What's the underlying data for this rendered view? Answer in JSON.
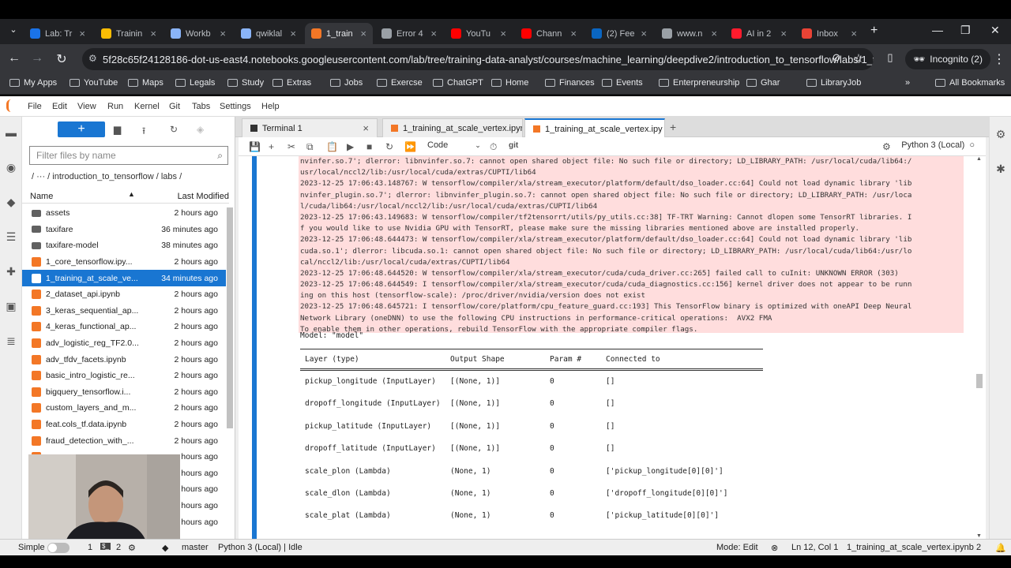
{
  "browser": {
    "tabs": [
      {
        "label": "Lab: Tr",
        "icon": "c-icon",
        "color": "#1a73e8"
      },
      {
        "label": "Trainin",
        "icon": "training-icon",
        "color": "#fbbc04"
      },
      {
        "label": "Workb",
        "icon": "workbench-icon",
        "color": "#8ab4f8"
      },
      {
        "label": "qwiklal",
        "icon": "qwiklabs-icon",
        "color": "#8ab4f8"
      },
      {
        "label": "1_train",
        "icon": "jupyter-icon",
        "color": "#f37726",
        "active": true
      },
      {
        "label": "Error 4",
        "icon": "globe-icon",
        "color": "#9aa0a6"
      },
      {
        "label": "YouTu",
        "icon": "youtube-icon",
        "color": "#ff0000"
      },
      {
        "label": "Chann",
        "icon": "youtube-icon",
        "color": "#ff0000"
      },
      {
        "label": "(2) Fee",
        "icon": "linkedin-icon",
        "color": "#0a66c2"
      },
      {
        "label": "www.n",
        "icon": "globe-icon",
        "color": "#9aa0a6"
      },
      {
        "label": "AI in 2",
        "icon": "opera-icon",
        "color": "#ff1b2d"
      },
      {
        "label": "Inbox",
        "icon": "gmail-icon",
        "color": "#ea4335"
      }
    ],
    "url": "5f28c65f24128186-dot-us-east4.notebooks.googleusercontent.com/lab/tree/training-data-analyst/courses/machine_learning/deepdive2/introduction_to_tensorflow/labs/1_train...",
    "incognito": "Incognito (2)",
    "bookmarks": [
      "My Apps",
      "YouTube",
      "Maps",
      "Legals",
      "Study",
      "Extras",
      "Jobs",
      "Exercse",
      "ChatGPT",
      "Home",
      "Finances",
      "Events",
      "Enterpreneurship",
      "Ghar",
      "LibraryJob"
    ],
    "all_bookmarks": "All Bookmarks"
  },
  "menubar": [
    "File",
    "Edit",
    "View",
    "Run",
    "Kernel",
    "Git",
    "Tabs",
    "Settings",
    "Help"
  ],
  "filebrowser": {
    "filter_placeholder": "Filter files by name",
    "breadcrumb": "/   ···   / introduction_to_tensorflow / labs /",
    "col_name": "Name",
    "col_modified": "Last Modified",
    "files": [
      {
        "name": "assets",
        "modified": "2 hours ago",
        "type": "folder"
      },
      {
        "name": "taxifare",
        "modified": "36 minutes ago",
        "type": "folder"
      },
      {
        "name": "taxifare-model",
        "modified": "38 minutes ago",
        "type": "folder"
      },
      {
        "name": "1_core_tensorflow.ipy...",
        "modified": "2 hours ago",
        "type": "notebook"
      },
      {
        "name": "1_training_at_scale_ve...",
        "modified": "34 minutes ago",
        "type": "notebook",
        "selected": true
      },
      {
        "name": "2_dataset_api.ipynb",
        "modified": "2 hours ago",
        "type": "notebook"
      },
      {
        "name": "3_keras_sequential_ap...",
        "modified": "2 hours ago",
        "type": "notebook"
      },
      {
        "name": "4_keras_functional_ap...",
        "modified": "2 hours ago",
        "type": "notebook"
      },
      {
        "name": "adv_logistic_reg_TF2.0...",
        "modified": "2 hours ago",
        "type": "notebook"
      },
      {
        "name": "adv_tfdv_facets.ipynb",
        "modified": "2 hours ago",
        "type": "notebook"
      },
      {
        "name": "basic_intro_logistic_re...",
        "modified": "2 hours ago",
        "type": "notebook"
      },
      {
        "name": "bigquery_tensorflow.i...",
        "modified": "2 hours ago",
        "type": "notebook"
      },
      {
        "name": "custom_layers_and_m...",
        "modified": "2 hours ago",
        "type": "notebook"
      },
      {
        "name": "feat.cols_tf.data.ipynb",
        "modified": "2 hours ago",
        "type": "notebook"
      },
      {
        "name": "fraud_detection_with_...",
        "modified": "2 hours ago",
        "type": "notebook"
      },
      {
        "name": "",
        "modified": "hours ago",
        "type": "notebook"
      },
      {
        "name": "",
        "modified": "hours ago",
        "type": "notebook"
      },
      {
        "name": "",
        "modified": "hours ago",
        "type": "notebook"
      },
      {
        "name": "",
        "modified": "hours ago",
        "type": "notebook"
      },
      {
        "name": "",
        "modified": "hours ago",
        "type": "notebook"
      }
    ]
  },
  "doctabs": [
    {
      "label": "Terminal 1",
      "icon": "terminal-icon"
    },
    {
      "label": "1_training_at_scale_vertex.ipyn",
      "icon": "notebook-icon"
    },
    {
      "label": "1_training_at_scale_vertex.ipy",
      "icon": "notebook-icon",
      "active": true
    }
  ],
  "toolbar": {
    "cell_type": "Code",
    "git": "git",
    "kernel": "Python 3 (Local)"
  },
  "stderr_lines": [
    "nvinfer.so.7'; dlerror: libnvinfer.so.7: cannot open shared object file: No such file or directory; LD_LIBRARY_PATH: /usr/local/cuda/lib64:/",
    "usr/local/nccl2/lib:/usr/local/cuda/extras/CUPTI/lib64",
    "2023-12-25 17:06:43.148767: W tensorflow/compiler/xla/stream_executor/platform/default/dso_loader.cc:64] Could not load dynamic library 'lib",
    "nvinfer_plugin.so.7'; dlerror: libnvinfer_plugin.so.7: cannot open shared object file: No such file or directory; LD_LIBRARY_PATH: /usr/loca",
    "l/cuda/lib64:/usr/local/nccl2/lib:/usr/local/cuda/extras/CUPTI/lib64",
    "2023-12-25 17:06:43.149683: W tensorflow/compiler/tf2tensorrt/utils/py_utils.cc:38] TF-TRT Warning: Cannot dlopen some TensorRT libraries. I",
    "f you would like to use Nvidia GPU with TensorRT, please make sure the missing libraries mentioned above are installed properly.",
    "2023-12-25 17:06:48.644473: W tensorflow/compiler/xla/stream_executor/platform/default/dso_loader.cc:64] Could not load dynamic library 'lib",
    "cuda.so.1'; dlerror: libcuda.so.1: cannot open shared object file: No such file or directory; LD_LIBRARY_PATH: /usr/local/cuda/lib64:/usr/lo",
    "cal/nccl2/lib:/usr/local/cuda/extras/CUPTI/lib64",
    "2023-12-25 17:06:48.644520: W tensorflow/compiler/xla/stream_executor/cuda/cuda_driver.cc:265] failed call to cuInit: UNKNOWN ERROR (303)",
    "2023-12-25 17:06:48.644549: I tensorflow/compiler/xla/stream_executor/cuda/cuda_diagnostics.cc:156] kernel driver does not appear to be runn",
    "ing on this host (tensorflow-scale): /proc/driver/nvidia/version does not exist",
    "2023-12-25 17:06:48.645721: I tensorflow/core/platform/cpu_feature_guard.cc:193] This TensorFlow binary is optimized with oneAPI Deep Neural",
    "Network Library (oneDNN) to use the following CPU instructions in performance-critical operations:  AVX2 FMA",
    "To enable them in other operations, rebuild TensorFlow with the appropriate compiler flags."
  ],
  "model_line": "Model: \"model\"",
  "summary": {
    "headers": [
      "Layer (type)",
      "Output Shape",
      "Param #",
      "Connected to"
    ],
    "rows": [
      [
        "pickup_longitude (InputLayer)",
        "[(None, 1)]",
        "0",
        "[]"
      ],
      [
        "dropoff_longitude (InputLayer)",
        "[(None, 1)]",
        "0",
        "[]"
      ],
      [
        "pickup_latitude (InputLayer)",
        "[(None, 1)]",
        "0",
        "[]"
      ],
      [
        "dropoff_latitude (InputLayer)",
        "[(None, 1)]",
        "0",
        "[]"
      ],
      [
        "scale_plon (Lambda)",
        "(None, 1)",
        "0",
        "['pickup_longitude[0][0]']"
      ],
      [
        "scale_dlon (Lambda)",
        "(None, 1)",
        "0",
        "['dropoff_longitude[0][0]']"
      ],
      [
        "scale_plat (Lambda)",
        "(None, 1)",
        "0",
        "['pickup_latitude[0][0]']"
      ]
    ]
  },
  "status": {
    "simple": "Simple",
    "n1": "1",
    "n2": "2",
    "branch": "master",
    "kernel_status": "Python 3 (Local) | Idle",
    "mode": "Mode: Edit",
    "position": "Ln 12, Col 1",
    "filename": "1_training_at_scale_vertex.ipynb",
    "count": "2"
  }
}
